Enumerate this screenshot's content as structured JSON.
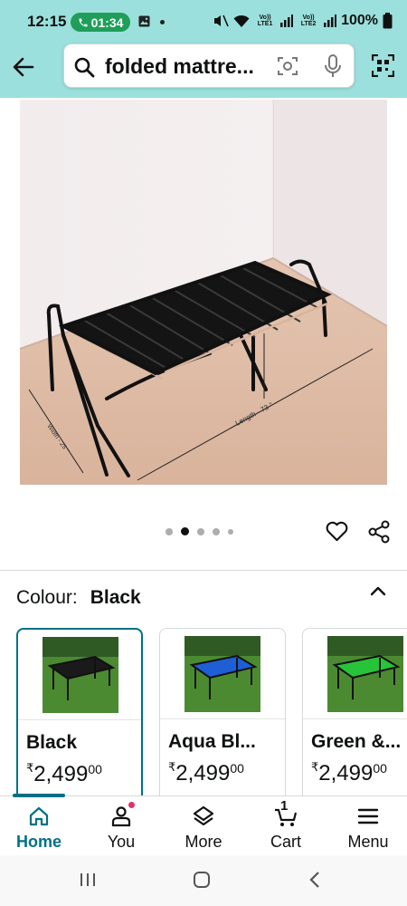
{
  "status_bar": {
    "time": "12:15",
    "call_timer": "01:34",
    "net1": "Vo)) LTE1",
    "net2": "Vo)) LTE2",
    "battery": "100%"
  },
  "search": {
    "query": "folded mattre..."
  },
  "carousel": {
    "dots": 5,
    "active_index": 1
  },
  "colour": {
    "label": "Colour:",
    "selected": "Black"
  },
  "swatches": [
    {
      "name": "Black",
      "currency": "₹",
      "price": "2,499",
      "paise": "00",
      "color": "#1a1a1a"
    },
    {
      "name": "Aqua Bl...",
      "currency": "₹",
      "price": "2,499",
      "paise": "00",
      "color": "#1e5fd6"
    },
    {
      "name": "Green &...",
      "currency": "₹",
      "price": "2,499",
      "paise": "00",
      "color": "#27c43a"
    }
  ],
  "bottom_nav": {
    "items": [
      {
        "label": "Home",
        "icon": "home-icon"
      },
      {
        "label": "You",
        "icon": "user-icon"
      },
      {
        "label": "More",
        "icon": "layers-icon"
      },
      {
        "label": "Cart",
        "icon": "cart-icon"
      },
      {
        "label": "Menu",
        "icon": "menu-icon"
      }
    ],
    "cart_count": "1"
  },
  "colors": {
    "header_bg": "#9be0dc",
    "accent": "#007185",
    "notification": "#e0316f"
  }
}
